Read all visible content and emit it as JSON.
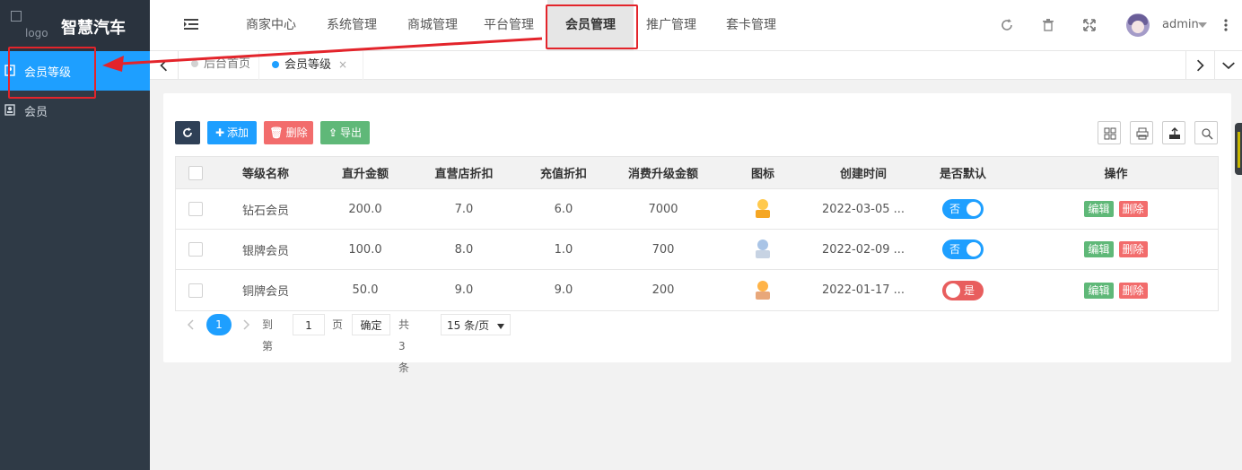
{
  "brand": {
    "logo_alt": "logo",
    "title": "智慧汽车"
  },
  "sidebar": {
    "items": [
      {
        "label": "会员等级",
        "icon": "member-level-icon",
        "active": true
      },
      {
        "label": "会员",
        "icon": "member-card-icon",
        "active": false
      }
    ]
  },
  "topnav": {
    "items": [
      "商家中心",
      "系统管理",
      "商城管理",
      "平台管理",
      "会员管理",
      "推广管理",
      "套卡管理"
    ],
    "active_index": 4,
    "icons": [
      "refresh-icon",
      "trash-icon",
      "fullscreen-icon"
    ],
    "user": "admin"
  },
  "tabs": {
    "items": [
      {
        "label": "后台首页",
        "active": false
      },
      {
        "label": "会员等级",
        "active": true,
        "closable": true,
        "close": "×"
      }
    ]
  },
  "toolbar": {
    "refresh": "refresh-icon",
    "add": "添加",
    "delete": "删除",
    "export": "导出"
  },
  "table": {
    "columns": [
      "等级名称",
      "直升金额",
      "直营店折扣",
      "充值折扣",
      "消费升级金额",
      "图标",
      "创建时间",
      "是否默认",
      "操作"
    ],
    "rows": [
      {
        "name": "钻石会员",
        "direct": "200.0",
        "store_discount": "7.0",
        "recharge_discount": "6.0",
        "upgrade": "7000",
        "icon": "gold-medal-icon",
        "created": "2022-03-05 ...",
        "default_label": "否",
        "default_on": false
      },
      {
        "name": "银牌会员",
        "direct": "100.0",
        "store_discount": "8.0",
        "recharge_discount": "1.0",
        "upgrade": "700",
        "icon": "silver-medal-icon",
        "created": "2022-02-09 ...",
        "default_label": "否",
        "default_on": false
      },
      {
        "name": "铜牌会员",
        "direct": "50.0",
        "store_discount": "9.0",
        "recharge_discount": "9.0",
        "upgrade": "200",
        "icon": "bronze-medal-icon",
        "created": "2022-01-17 ...",
        "default_label": "是",
        "default_on": true
      }
    ],
    "actions": {
      "edit": "编辑",
      "delete": "删除"
    }
  },
  "pager": {
    "current": "1",
    "goto": "到第",
    "page_input": "1",
    "page_unit": "页",
    "confirm": "确定",
    "total": "共 3 条",
    "size": "15 条/页"
  },
  "colors": {
    "sidebar": "#2f3a46",
    "accent": "#1e9fff",
    "green": "#5fb878",
    "red": "#f26c6c",
    "dark": "#2f4056",
    "switch_on": "#e85e5e",
    "highlight": "#e3242b"
  }
}
